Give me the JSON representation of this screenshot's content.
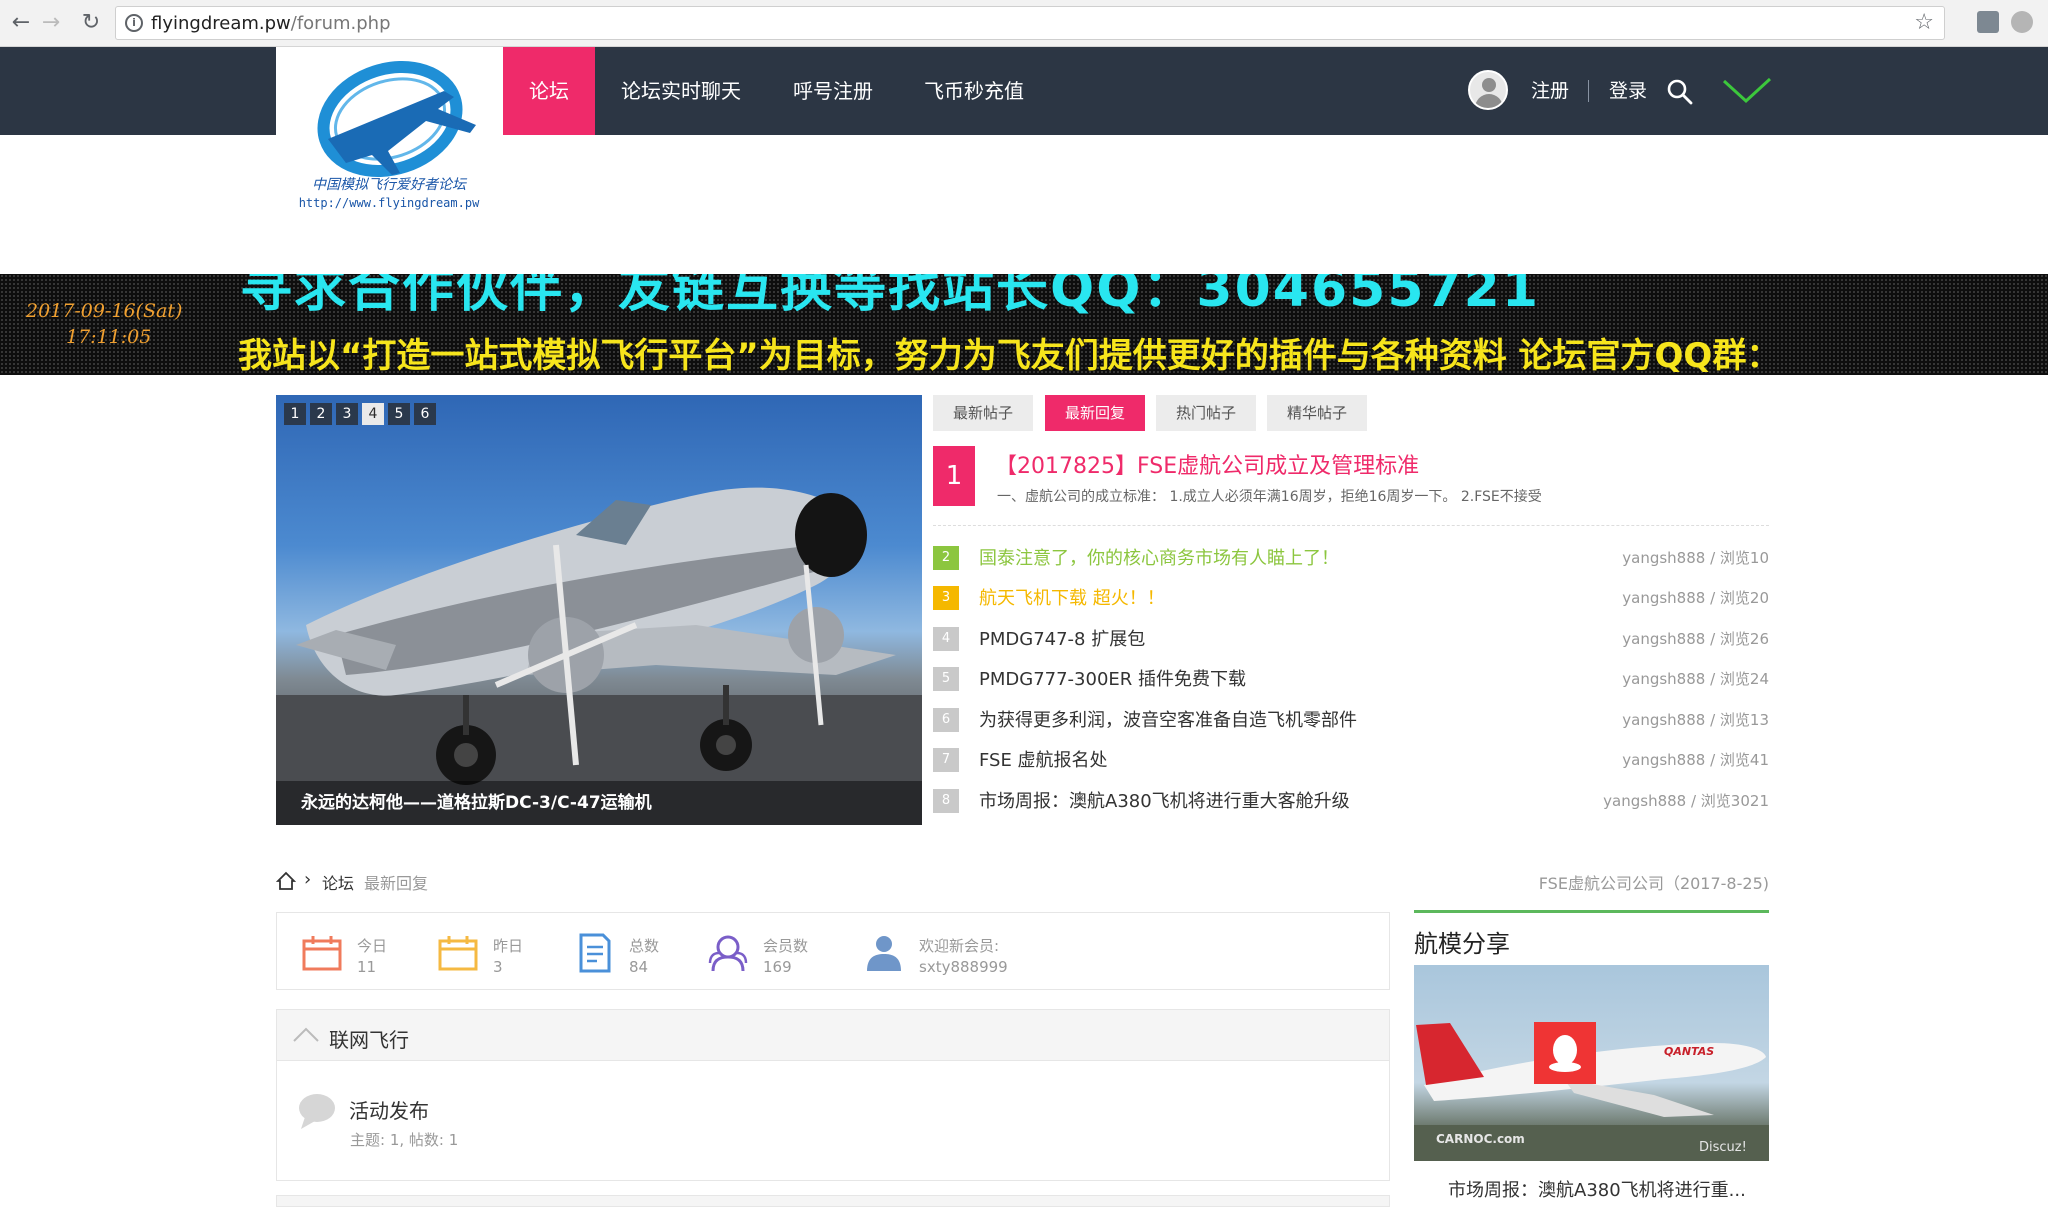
{
  "browser": {
    "url_host": "flyingdream.pw",
    "url_path": "/forum.php"
  },
  "header": {
    "logo_line1": "中国模拟飞行爱好者论坛",
    "logo_line2": "http://www.flyingdream.pw",
    "nav": [
      {
        "label": "论坛",
        "active": true
      },
      {
        "label": "论坛实时聊天"
      },
      {
        "label": "呼号注册"
      },
      {
        "label": "飞币秒充值"
      }
    ],
    "register": "注册",
    "login": "登录",
    "sep": "|"
  },
  "banner": {
    "cyan_text": "寻求合作伙伴，友链互换等找站长QQ：304655721",
    "date": "2017-09-16(Sat)",
    "time": "17:11:05",
    "yellow_text": "我站以“打造一站式模拟飞行平台”为目标，努力为飞友们提供更好的插件与各种资料 论坛官方QQ群："
  },
  "slideshow": {
    "numbers": [
      "1",
      "2",
      "3",
      "4",
      "5",
      "6"
    ],
    "active_index": 3,
    "caption": "永远的达柯他——道格拉斯DC-3/C-47运输机"
  },
  "tabs": [
    {
      "label": "最新帖子"
    },
    {
      "label": "最新回复",
      "active": true
    },
    {
      "label": "热门帖子"
    },
    {
      "label": "精华帖子"
    }
  ],
  "featured": {
    "num": "1",
    "title": "【2017825】FSE虚航公司成立及管理标准",
    "desc": "一、虚航公司的成立标准： 1.成立人必须年满16周岁，拒绝16周岁一下。 2.FSE不接受"
  },
  "threads": [
    {
      "num": "2",
      "title": "国泰注意了，你的核心商务市场有人瞄上了！",
      "meta": "yangsh888 / 浏览10",
      "color": "#8cc63f"
    },
    {
      "num": "3",
      "title": "航天飞机下载 超火！！",
      "meta": "yangsh888 / 浏览20",
      "color": "#f5b800"
    },
    {
      "num": "4",
      "title": "PMDG747-8 扩展包",
      "meta": "yangsh888 / 浏览26"
    },
    {
      "num": "5",
      "title": "PMDG777-300ER 插件免费下载",
      "meta": "yangsh888 / 浏览24"
    },
    {
      "num": "6",
      "title": "为获得更多利润，波音空客准备自造飞机零部件",
      "meta": "yangsh888 / 浏览13"
    },
    {
      "num": "7",
      "title": "FSE 虚航报名处",
      "meta": "yangsh888 / 浏览41"
    },
    {
      "num": "8",
      "title": "市场周报：澳航A380飞机将进行重大客舱升级",
      "meta": "yangsh888 / 浏览3021"
    }
  ],
  "breadcrumb": {
    "arrow": "›",
    "forum": "论坛",
    "current": "最新回复",
    "right": "FSE虚航公司公司（2017-8-25)"
  },
  "stats": [
    {
      "label": "今日",
      "value": "11",
      "icon": "calendar-icon"
    },
    {
      "label": "昨日",
      "value": "3",
      "icon": "calendar-icon"
    },
    {
      "label": "总数",
      "value": "84",
      "icon": "document-icon"
    },
    {
      "label": "会员数",
      "value": "169",
      "icon": "members-icon"
    },
    {
      "label": "欢迎新会员:",
      "value": "sxty888999",
      "icon": "user-icon"
    }
  ],
  "forum_section": {
    "title": "联网飞行",
    "forum_name": "活动发布",
    "forum_meta": "主题: 1, 帖数: 1"
  },
  "sidebar": {
    "title": "航模分享",
    "caption": "市场周报：澳航A380飞机将进行重...",
    "image_text_left": "CARNOC.com",
    "image_text_right": "Discuz!"
  },
  "colors": {
    "accent": "#ef2a6a",
    "topbar": "#2c3644",
    "banner_cyan": "#29e6f0",
    "banner_yellow": "#f7e51c",
    "green_rule": "#5cb85c"
  }
}
